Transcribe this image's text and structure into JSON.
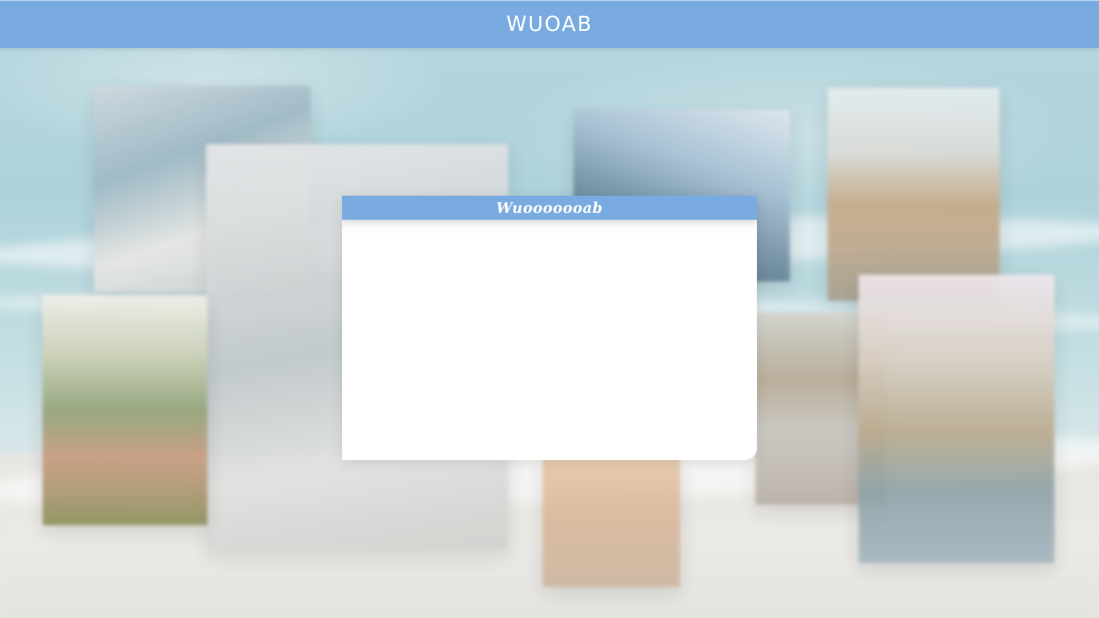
{
  "header": {
    "title": "WUOAB"
  },
  "dialog": {
    "title": "Wuooooooab"
  },
  "background": {
    "photos": [
      {
        "name": "photo-house-window"
      },
      {
        "name": "photo-interior-white"
      },
      {
        "name": "photo-mountain-sky"
      },
      {
        "name": "photo-road-desert"
      },
      {
        "name": "photo-couple-mountain"
      },
      {
        "name": "photo-sand-footprints"
      },
      {
        "name": "photo-street-town"
      },
      {
        "name": "photo-tower-friends"
      }
    ]
  },
  "colors": {
    "accent": "#79abe0",
    "dialog_background": "#ffffff",
    "header_text": "#ffffff"
  }
}
